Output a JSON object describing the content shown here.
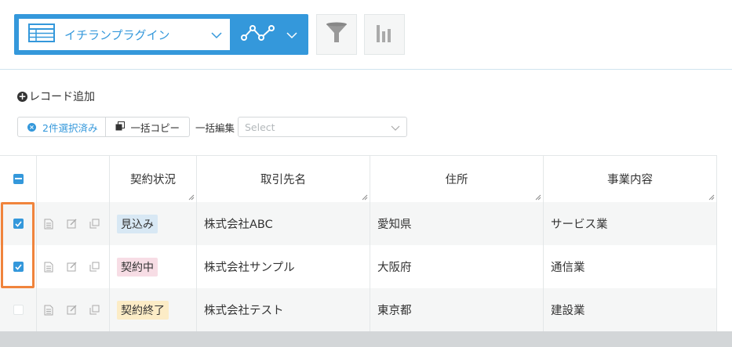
{
  "toolbar": {
    "view_name": "イチランプラグイン",
    "table-icon": "table-icon",
    "graph_icon": "line-graph-icon",
    "filter_icon": "funnel-icon",
    "aggregate_icon": "bar-chart-icon"
  },
  "actions": {
    "add_record": "レコード追加",
    "selected": "2件選択済み",
    "bulk_copy": "一括コピー",
    "bulk_edit_label": "一括編集",
    "bulk_edit_placeholder": "Select"
  },
  "table": {
    "columns": [
      "契約状況",
      "取引先名",
      "住所",
      "事業内容"
    ],
    "rows": [
      {
        "checked": true,
        "status": "見込み",
        "status_color": "#d8e8f4",
        "name": "株式会社ABC",
        "address": "愛知県",
        "business": "サービス業"
      },
      {
        "checked": true,
        "status": "契約中",
        "status_color": "#f7dde5",
        "name": "株式会社サンプル",
        "address": "大阪府",
        "business": "通信業"
      },
      {
        "checked": false,
        "status": "契約終了",
        "status_color": "#fcecc6",
        "name": "株式会社テスト",
        "address": "東京都",
        "business": "建設業"
      }
    ]
  },
  "colors": {
    "accent": "#3498db",
    "highlight": "#f0843c"
  }
}
